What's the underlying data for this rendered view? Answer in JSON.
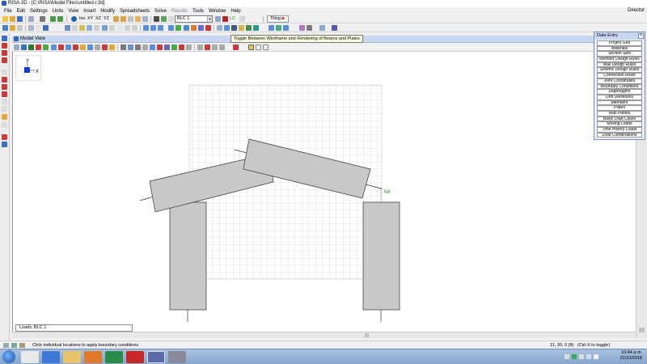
{
  "window": {
    "title": "RISA-3D - [C:\\RISA\\Model Files\\untitled-r.3d]",
    "right_label": "Director"
  },
  "menu": [
    "File",
    "Edit",
    "Settings",
    "Units",
    "View",
    "Insert",
    "Modify",
    "Spreadsheets",
    "Solve",
    "Results",
    "Tools",
    "Window",
    "Help"
  ],
  "menu_disabled": [
    "Results"
  ],
  "toolbar": {
    "tiling_label": "Tiling",
    "view_labels": [
      "Iso",
      "XY",
      "XZ",
      "YZ"
    ],
    "lc_combo": "BLC 1",
    "lc_label": "LC"
  },
  "model_view": {
    "title": "Model View",
    "tooltip": "Toggle Between Wireframe and Rendering of Beams and Plates",
    "axis_y": "Y",
    "axis_x": "X",
    "node_label": "N4",
    "loads_label": "Loads: BLC 1"
  },
  "data_entry": {
    "title": "Data Entry",
    "items": [
      "Project Grid",
      "Materials",
      "Section Sets",
      "Member Design Rules",
      "Wall Design Rules",
      "Seismic Design Rules",
      "Connection Rules",
      "Joint Coordinates",
      "Boundary Conditions",
      "Diaphragms",
      "Drift Definitions",
      "Members",
      "Plates",
      "Wall Panels",
      "Basic Load Cases",
      "Moving Loads",
      "Time History Loads",
      "Load Combinations"
    ]
  },
  "status": {
    "message": "Click individual locations to apply boundary conditions",
    "coords": "11, 30, 0 (ft)",
    "toggle_hint": "(Ctrl-X to toggle)"
  },
  "taskbar": {
    "time": "10:44 a.m.",
    "date": "22/10/2018"
  },
  "colors": {
    "titlebar": "#c8d7ef",
    "member_fill": "#c8c8c8",
    "grid": "#c9c9c9",
    "node": "#2e8b2e"
  }
}
